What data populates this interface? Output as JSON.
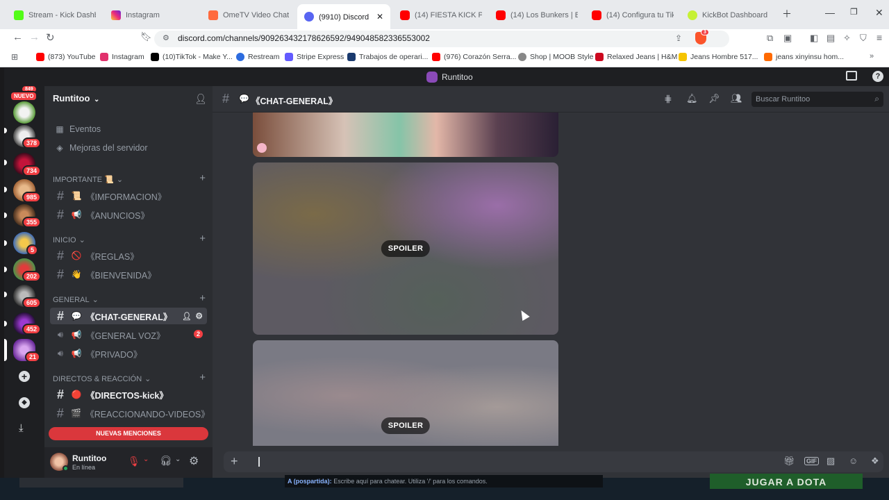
{
  "browser": {
    "tabs": [
      {
        "title": "Stream - Kick Dashb",
        "color": "#53fc18"
      },
      {
        "title": "Instagram",
        "color": "#e1306c"
      },
      {
        "title": "OmeTV Video Chat",
        "color": "#ff6a3d"
      },
      {
        "title": "(9910) Discord | #💬",
        "color": "#5865f2",
        "active": true
      },
      {
        "title": "(14) FIESTA KICK PERU",
        "color": "#ff0000"
      },
      {
        "title": "(14) Los Bunkers | Baila",
        "color": "#ff0000"
      },
      {
        "title": "(14) Configura tu TikTo",
        "color": "#ff0000"
      },
      {
        "title": "KickBot Dashboard",
        "color": "#c6f135"
      }
    ],
    "url": "discord.com/channels/909263432178626592/949048582336553002",
    "bookmarks": [
      {
        "label": "(873) YouTube",
        "color": "#ff0000"
      },
      {
        "label": "Instagram",
        "color": "#e1306c"
      },
      {
        "label": "(10)TikTok - Make Y...",
        "color": "#000000"
      },
      {
        "label": "Restream",
        "color": "#2d6cdf"
      },
      {
        "label": "Stripe Express",
        "color": "#635bff"
      },
      {
        "label": "Trabajos de operari...",
        "color": "#1a3a6e"
      },
      {
        "label": "(976) Corazón Serra...",
        "color": "#ff0000"
      },
      {
        "label": "Shop | MOOB Style",
        "color": "#555555"
      },
      {
        "label": "Relaxed Jeans | H&M",
        "color": "#cc071e"
      },
      {
        "label": "Jeans Hombre 517...",
        "color": "#f5c400"
      },
      {
        "label": "jeans xinyinsu hom...",
        "color": "#ff6a00"
      }
    ],
    "extension_badge": "3"
  },
  "discord": {
    "window_title": "Runtitoo",
    "server_name": "Runtitoo",
    "guild_badges": {
      "top": "849",
      "nuevo": "NUEVO",
      "list": [
        "378",
        "734",
        "985",
        "355",
        "5",
        "202",
        "605",
        "452",
        "21"
      ]
    },
    "sidebar": {
      "top_items": [
        "Eventos",
        "Mejoras del servidor"
      ],
      "categories": [
        {
          "name": "IMPORTANTE 📜",
          "channels": [
            {
              "emoji": "📜",
              "name": "《IMFORMACION》"
            },
            {
              "emoji": "📢",
              "name": "《ANUNCIOS》"
            }
          ]
        },
        {
          "name": "INICIO",
          "channels": [
            {
              "emoji": "🚫",
              "name": "《REGLAS》"
            },
            {
              "emoji": "👋",
              "name": "《BIENVENIDA》"
            }
          ]
        },
        {
          "name": "GENERAL",
          "channels": [
            {
              "emoji": "💬",
              "name": "《CHAT-GENERAL》"
            },
            {
              "emoji": "📢",
              "name": "《GENERAL VOZ》",
              "badge": "2"
            },
            {
              "emoji": "📢",
              "name": "《PRIVADO》"
            }
          ]
        },
        {
          "name": "DIRECTOS & REACCIÓN",
          "channels": [
            {
              "emoji": "🔴",
              "name": "《DIRECTOS-kick》"
            },
            {
              "emoji": "🎬",
              "name": "《REACCIONANDO-VIDEOS》"
            }
          ]
        }
      ],
      "new_mentions": "NUEVAS MENCIONES"
    },
    "user": {
      "name": "Runtitoo",
      "status": "En línea"
    },
    "channel_header": {
      "name": "《CHAT-GENERAL》",
      "search_placeholder": "Buscar Runtitoo"
    },
    "media": [
      {
        "spoiler_label": "SPOILER"
      },
      {
        "spoiler_label": "SPOILER"
      }
    ]
  },
  "taskbar": {
    "chat_prefix": "A (pospartida):",
    "chat_hint": "Escribe aquí para chatear. Utiliza '/' para los comandos.",
    "game_button": "JUGAR A DOTA"
  }
}
